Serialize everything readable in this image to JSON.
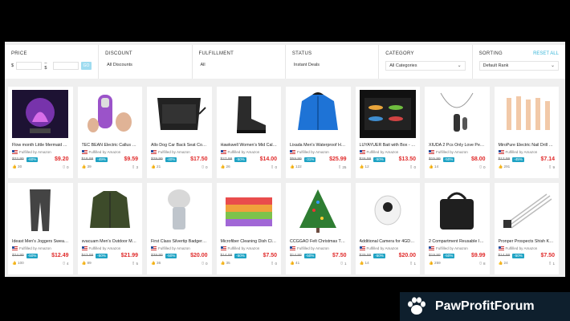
{
  "filters": {
    "price": {
      "label": "PRICE",
      "from_prefix": "$",
      "to_sep": "– $",
      "go": "GO"
    },
    "discount": {
      "label": "DISCOUNT",
      "value": "All Discounts"
    },
    "fulfillment": {
      "label": "FULFILLMENT",
      "value": "All"
    },
    "status": {
      "label": "STATUS",
      "value": "Instant Deals"
    },
    "category": {
      "label": "CATEGORY",
      "value": "All Categories"
    },
    "sorting": {
      "label": "SORTING",
      "value": "Default Rank",
      "reset": "RESET ALL"
    }
  },
  "fulfilled_text": "Fulfilled by Amazon",
  "products": [
    {
      "title": "Flow month Little Mermaid Toy...",
      "orig": "$22.99",
      "disc": "-60%",
      "price": "$9.20",
      "likes": "30",
      "comments": "0",
      "icon": "mermaid-lamp"
    },
    {
      "title": "TEC BEAN Electric Callus Re...",
      "orig": "$18.99",
      "disc": "-49%",
      "price": "$9.59",
      "likes": "39",
      "comments": "3",
      "icon": "callus-remover"
    },
    {
      "title": "Allo Dog Car Back Seat Cover...",
      "orig": "$29.99",
      "disc": "-40%",
      "price": "$17.50",
      "likes": "21",
      "comments": "0",
      "icon": "seat-cover"
    },
    {
      "title": "Hawkwell Women's Mid Calf L...",
      "orig": "$27.99",
      "disc": "-50%",
      "price": "$14.00",
      "likes": "26",
      "comments": "0",
      "icon": "boot"
    },
    {
      "title": "Lixada Men's Waterproof Hoo...",
      "orig": "$59.99",
      "disc": "-31%",
      "price": "$25.99",
      "likes": "122",
      "comments": "25",
      "icon": "jacket"
    },
    {
      "title": "LUYAYUER Bait with Box - 4 ...",
      "orig": "$26.99",
      "disc": "-50%",
      "price": "$13.50",
      "likes": "12",
      "comments": "0",
      "icon": "bait-box"
    },
    {
      "title": "XIUDA 2 Pcs Only Love Pet U...",
      "orig": "$15.99",
      "disc": "-50%",
      "price": "$8.00",
      "likes": "14",
      "comments": "0",
      "icon": "necklace"
    },
    {
      "title": "MiroPure Electric Nail Drill Ma...",
      "orig": "$12.99",
      "disc": "-45%",
      "price": "$7.14",
      "likes": "291",
      "comments": "9",
      "icon": "nail-drill"
    },
    {
      "title": "Ideast Men's Joggers Sweatp...",
      "orig": "$24.99",
      "disc": "-50%",
      "price": "$12.49",
      "likes": "100",
      "comments": "4",
      "icon": "joggers"
    },
    {
      "title": "svacuam Men's Outdoor Men'...",
      "orig": "$43.99",
      "disc": "-50%",
      "price": "$21.99",
      "likes": "89",
      "comments": "5",
      "icon": "green-jacket"
    },
    {
      "title": "First Class Silvertip Badger Ha...",
      "orig": "$39.99",
      "disc": "-50%",
      "price": "$20.00",
      "likes": "36",
      "comments": "0",
      "icon": "shaving-brush"
    },
    {
      "title": "Microfiber Cleaning Dish Cloth...",
      "orig": "$14.99",
      "disc": "-50%",
      "price": "$7.50",
      "likes": "35",
      "comments": "0",
      "icon": "cloths"
    },
    {
      "title": "CCGGAO Felt Christmas Tree...",
      "orig": "$14.99",
      "disc": "-50%",
      "price": "$7.50",
      "likes": "41",
      "comments": "1",
      "icon": "felt-tree"
    },
    {
      "title": "Additional Camera for 4GDOT...",
      "orig": "$39.99",
      "disc": "-50%",
      "price": "$20.00",
      "likes": "14",
      "comments": "1",
      "icon": "camera"
    },
    {
      "title": "2 Compartment Reusable Insu...",
      "orig": "$19.99",
      "disc": "-50%",
      "price": "$9.99",
      "likes": "259",
      "comments": "8",
      "icon": "lunch-bag"
    },
    {
      "title": "Pronper Prospects Shish Kab...",
      "orig": "$14.99",
      "disc": "-50%",
      "price": "$7.50",
      "likes": "24",
      "comments": "1",
      "icon": "skewers"
    }
  ],
  "watermark": {
    "text": "PawProfitForum"
  }
}
